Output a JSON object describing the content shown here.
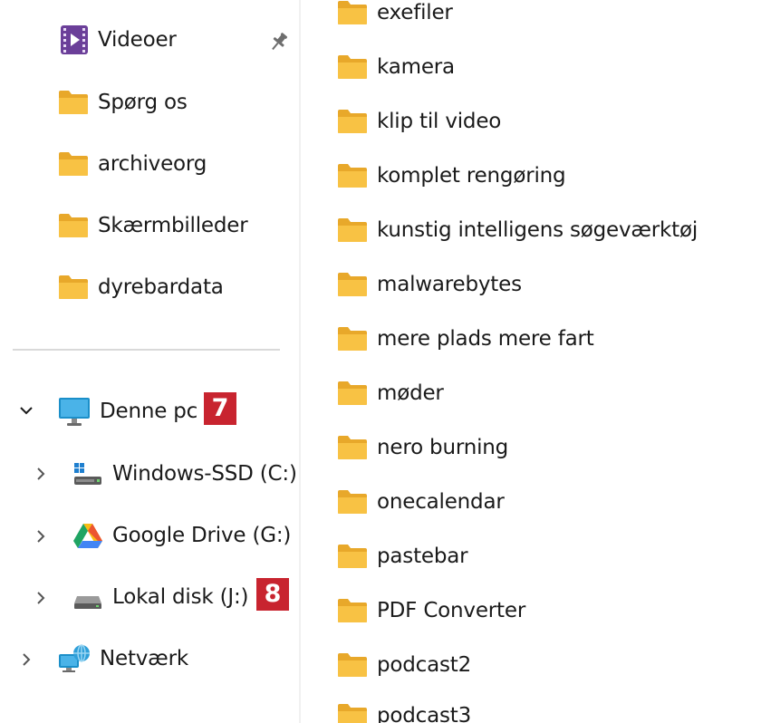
{
  "colors": {
    "folder": "#f8c244",
    "folder_back": "#e8a82a",
    "badge": "#c8242f",
    "text": "#1a1a1a",
    "separator": "#d9d9d9"
  },
  "sidebar": {
    "quick_access": [
      {
        "label": "Videoer",
        "icon": "video-folder-icon",
        "pinned": true
      },
      {
        "label": "Spørg os",
        "icon": "folder-icon"
      },
      {
        "label": "archiveorg",
        "icon": "folder-icon"
      },
      {
        "label": "Skærmbilleder",
        "icon": "folder-icon"
      },
      {
        "label": "dyrebardata",
        "icon": "folder-icon"
      }
    ],
    "this_pc": {
      "label": "Denne pc",
      "icon": "monitor-icon",
      "badge": "7",
      "drives": [
        {
          "label": "Windows-SSD (C:)",
          "icon": "windows-drive-icon"
        },
        {
          "label": "Google Drive (G:)",
          "icon": "google-drive-icon"
        },
        {
          "label": "Lokal disk (J:)",
          "icon": "local-disk-icon",
          "badge": "8"
        }
      ]
    },
    "network": {
      "label": "Netværk",
      "icon": "network-icon"
    }
  },
  "files": [
    "exefiler",
    "kamera",
    "klip til video",
    "komplet rengøring",
    "kunstig intelligens søgeværktøj",
    "malwarebytes",
    "mere plads mere fart",
    "møder",
    "nero burning",
    "onecalendar",
    "pastebar",
    "PDF Converter",
    "podcast2",
    "podcast3"
  ]
}
